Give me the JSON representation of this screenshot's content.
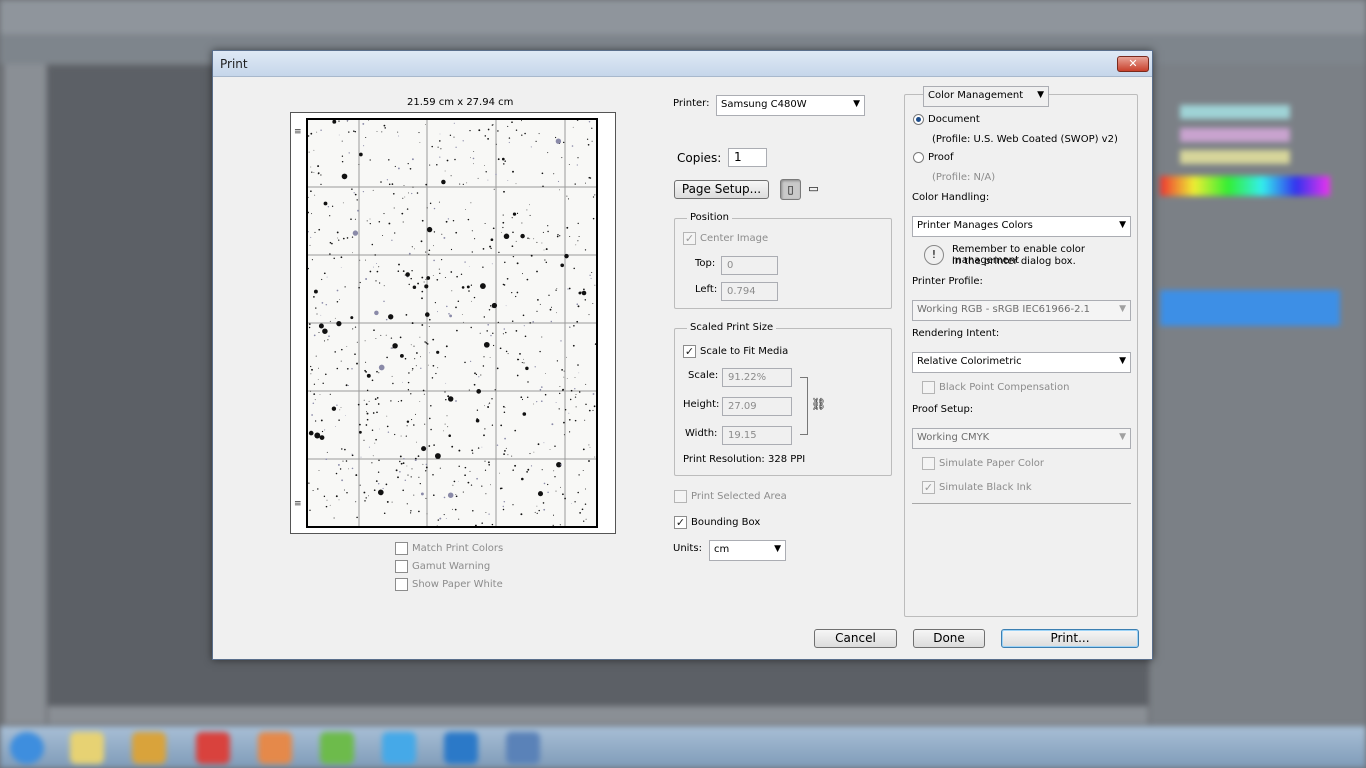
{
  "dialog": {
    "title": "Print",
    "close_label": "✕"
  },
  "preview": {
    "paper_size": "21.59 cm x 27.94 cm",
    "checkboxes": [
      {
        "label": "Match Print Colors",
        "checked": false
      },
      {
        "label": "Gamut Warning",
        "checked": false
      },
      {
        "label": "Show Paper White",
        "checked": false
      }
    ]
  },
  "printer": {
    "label": "Printer:",
    "value": "Samsung C480W"
  },
  "copies": {
    "label": "Copies:",
    "value": "1"
  },
  "page_setup": {
    "label": "Page Setup..."
  },
  "orientation": {
    "portrait_icon": "portrait-orientation-icon",
    "landscape_icon": "landscape-orientation-icon"
  },
  "position": {
    "title": "Position",
    "center_image": "Center Image",
    "top_label": "Top:",
    "top_value": "0",
    "left_label": "Left:",
    "left_value": "0.794"
  },
  "scaled": {
    "title": "Scaled Print Size",
    "scale_to_fit": "Scale to Fit Media",
    "scale_label": "Scale:",
    "scale_value": "91.22%",
    "height_label": "Height:",
    "height_value": "27.09",
    "width_label": "Width:",
    "width_value": "19.15",
    "resolution": "Print Resolution: 328 PPI"
  },
  "print_selected_area": "Print Selected Area",
  "bounding_box": "Bounding Box",
  "units": {
    "label": "Units:",
    "value": "cm"
  },
  "color": {
    "section_select": "Color Management",
    "document_label": "Document",
    "document_profile": "(Profile: U.S. Web Coated (SWOP) v2)",
    "proof_label": "Proof",
    "proof_profile": "(Profile: N/A)",
    "handling_label": "Color Handling:",
    "handling_value": "Printer Manages Colors",
    "warning_text_1": "Remember to enable color management",
    "warning_text_2": "in the printer dialog box.",
    "printer_profile_label": "Printer Profile:",
    "printer_profile_value": "Working RGB - sRGB IEC61966-2.1",
    "rendering_label": "Rendering Intent:",
    "rendering_value": "Relative Colorimetric",
    "black_point": "Black Point Compensation",
    "proof_setup_label": "Proof Setup:",
    "proof_setup_value": "Working CMYK",
    "simulate_paper": "Simulate Paper Color",
    "simulate_ink": "Simulate Black Ink"
  },
  "buttons": {
    "cancel": "Cancel",
    "done": "Done",
    "print": "Print..."
  }
}
